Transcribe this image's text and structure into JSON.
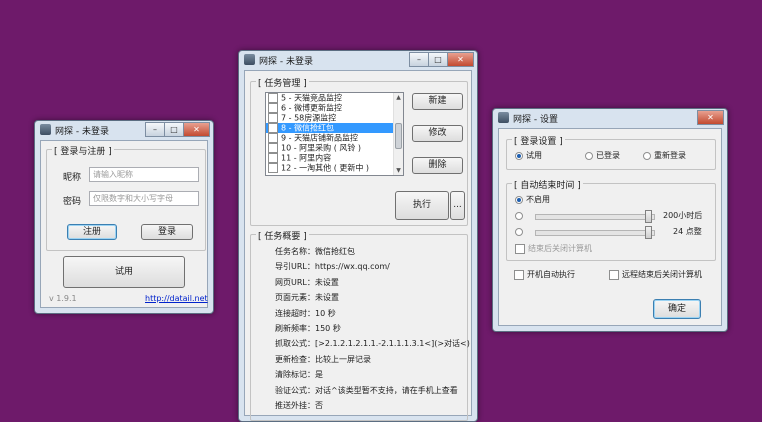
{
  "login_window": {
    "title": "网探 - 未登录",
    "group_label": "[ 登录与注册 ]",
    "nickname_label": "昵称",
    "nickname_placeholder": "请输入昵称",
    "password_label": "密码",
    "password_placeholder": "仅限数字和大小写字母",
    "register_label": "注册",
    "login_label": "登录",
    "trial_label": "试用",
    "version": "v 1.9.1",
    "link": "http://datail.net"
  },
  "main_window": {
    "title": "网探 - 未登录",
    "tasks_label": "[ 任务管理 ]",
    "tasks": [
      {
        "label": "5 - 天猫竞品监控",
        "selected": false
      },
      {
        "label": "6 - 微博更新监控",
        "selected": false
      },
      {
        "label": "7 - 58房源监控",
        "selected": false
      },
      {
        "label": "8 - 微信抢红包",
        "selected": true
      },
      {
        "label": "9 - 天猫店铺新品监控",
        "selected": false
      },
      {
        "label": "10 - 阿里采购 ( 风铃 )",
        "selected": false
      },
      {
        "label": "11 - 阿里内容",
        "selected": false
      },
      {
        "label": "12 - 一淘其他 ( 更新中 )",
        "selected": false
      }
    ],
    "new_label": "新建",
    "edit_label": "修改",
    "delete_label": "删除",
    "run_label": "执行",
    "more_label": "...",
    "summary_label": "[ 任务概要 ]",
    "summary": [
      {
        "key": "任务名称",
        "value": "微信抢红包"
      },
      {
        "key": "导引URL",
        "value": "https://wx.qq.com/"
      },
      {
        "key": "网页URL",
        "value": "未设置"
      },
      {
        "key": "页面元素",
        "value": "未设置"
      },
      {
        "key": "连接超时",
        "value": "10 秒"
      },
      {
        "key": "刷新频率",
        "value": "150 秒"
      },
      {
        "key": "抓取公式",
        "value": "[>2.1.2.1.2.1.1.-2.1.1.1.3.1<](>对话<)"
      },
      {
        "key": "更新检查",
        "value": "比较上一屏记录"
      },
      {
        "key": "清除标记",
        "value": "是"
      },
      {
        "key": "验证公式",
        "value": "对话^该类型暂不支持，请在手机上查看"
      },
      {
        "key": "推送外挂",
        "value": "否"
      }
    ]
  },
  "settings_window": {
    "title": "网探 - 设置",
    "login_group_label": "[ 登录设置 ]",
    "radio_trial": "试用",
    "radio_logged": "已登录",
    "radio_relogin": "重新登录",
    "autoend_group_label": "[ 自动结束时间 ]",
    "radio_disabled": "不启用",
    "slider1_value": "200小时后",
    "slider2_value": "24 点整",
    "shutdown_after_end": "结束后关闭计算机",
    "startup_label": "开机自动执行",
    "remote_shutdown_label": "远程结束后关闭计算机",
    "ok_label": "确定"
  },
  "icons": {
    "app": "app-icon",
    "minimize": "minimize-icon",
    "maximize": "maximize-icon",
    "close": "close-icon"
  }
}
